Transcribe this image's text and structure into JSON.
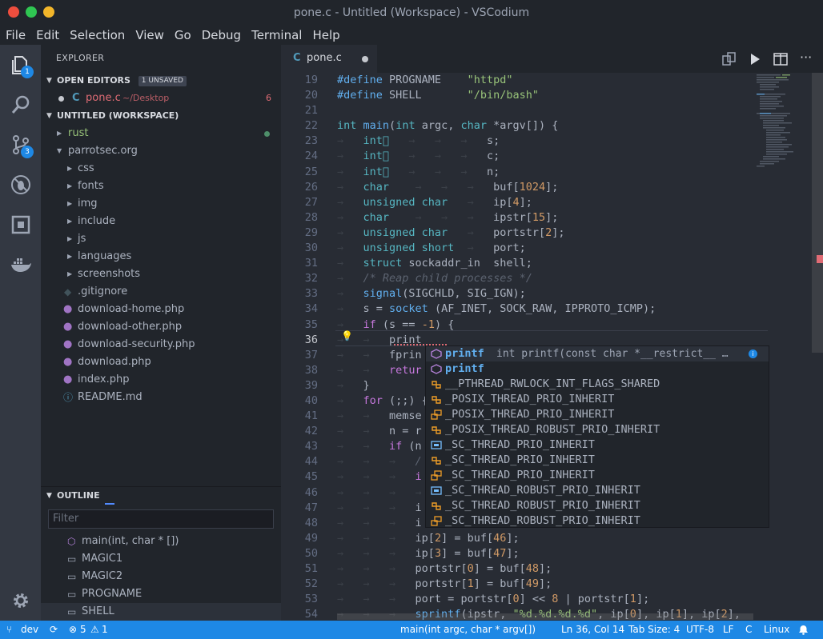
{
  "window": {
    "title": "pone.c - Untitled (Workspace) - VSCodium"
  },
  "menu": [
    "File",
    "Edit",
    "Selection",
    "View",
    "Go",
    "Debug",
    "Terminal",
    "Help"
  ],
  "activity": {
    "explorer_badge": "1",
    "scm_badge": "3"
  },
  "sidebar": {
    "header": "EXPLORER",
    "open_editors": {
      "title": "OPEN EDITORS",
      "badge": "1 UNSAVED",
      "items": [
        {
          "icon": "C",
          "name": "pone.c",
          "path": "~/Desktop",
          "problems": "6"
        }
      ]
    },
    "workspace": {
      "title": "UNTITLED (WORKSPACE)",
      "items": [
        {
          "name": "rust",
          "kind": "folder",
          "depth": 0
        },
        {
          "name": "parrotsec.org",
          "kind": "folder-open",
          "depth": 0
        },
        {
          "name": "css",
          "kind": "folder",
          "depth": 1
        },
        {
          "name": "fonts",
          "kind": "folder",
          "depth": 1
        },
        {
          "name": "img",
          "kind": "folder",
          "depth": 1
        },
        {
          "name": "include",
          "kind": "folder",
          "depth": 1
        },
        {
          "name": "js",
          "kind": "folder",
          "depth": 1
        },
        {
          "name": "languages",
          "kind": "folder",
          "depth": 1
        },
        {
          "name": "screenshots",
          "kind": "folder",
          "depth": 1
        },
        {
          "name": ".gitignore",
          "kind": "git",
          "depth": 1
        },
        {
          "name": "download-home.php",
          "kind": "php",
          "depth": 1
        },
        {
          "name": "download-other.php",
          "kind": "php",
          "depth": 1
        },
        {
          "name": "download-security.php",
          "kind": "php",
          "depth": 1
        },
        {
          "name": "download.php",
          "kind": "php",
          "depth": 1
        },
        {
          "name": "index.php",
          "kind": "php",
          "depth": 1
        },
        {
          "name": "README.md",
          "kind": "info",
          "depth": 1
        }
      ]
    },
    "outline": {
      "title": "OUTLINE",
      "filter_placeholder": "Filter",
      "items": [
        "main(int, char * [])",
        "MAGIC1",
        "MAGIC2",
        "PROGNAME",
        "SHELL"
      ]
    }
  },
  "editor": {
    "tab_icon": "C",
    "tab_name": "pone.c",
    "line_numbers": [
      "19",
      "20",
      "21",
      "22",
      "23",
      "24",
      "25",
      "26",
      "27",
      "28",
      "29",
      "30",
      "31",
      "32",
      "33",
      "34",
      "35",
      "36",
      "37",
      "38",
      "39",
      "40",
      "41",
      "42",
      "43",
      "44",
      "45",
      "46",
      "47",
      "48",
      "49",
      "50",
      "51",
      "52",
      "53",
      "54"
    ],
    "active_line": "36"
  },
  "suggest": {
    "items": [
      {
        "label": "printf",
        "detail": "int printf(const char *__restrict__ …",
        "kind": "function"
      },
      {
        "label": "printf",
        "detail": "",
        "kind": "function"
      },
      {
        "label": "__PTHREAD_RWLOCK_INT_FLAGS_SHARED",
        "detail": "",
        "kind": "constant"
      },
      {
        "label": "_POSIX_THREAD_PRIO_INHERIT",
        "detail": "",
        "kind": "constant"
      },
      {
        "label": "_POSIX_THREAD_PRIO_INHERIT",
        "detail": "",
        "kind": "enum"
      },
      {
        "label": "_POSIX_THREAD_ROBUST_PRIO_INHERIT",
        "detail": "",
        "kind": "constant"
      },
      {
        "label": "_SC_THREAD_PRIO_INHERIT",
        "detail": "",
        "kind": "member"
      },
      {
        "label": "_SC_THREAD_PRIO_INHERIT",
        "detail": "",
        "kind": "constant"
      },
      {
        "label": "_SC_THREAD_PRIO_INHERIT",
        "detail": "",
        "kind": "enum"
      },
      {
        "label": "_SC_THREAD_ROBUST_PRIO_INHERIT",
        "detail": "",
        "kind": "member"
      },
      {
        "label": "_SC_THREAD_ROBUST_PRIO_INHERIT",
        "detail": "",
        "kind": "constant"
      },
      {
        "label": "_SC_THREAD_ROBUST_PRIO_INHERIT",
        "detail": "",
        "kind": "enum"
      }
    ]
  },
  "status": {
    "branch": "dev",
    "errors": "5",
    "warnings": "1",
    "symbol": "main(int argc, char * argv[])",
    "position": "Ln 36, Col 14",
    "tab_size": "Tab Size: 4",
    "encoding": "UTF-8",
    "eol": "LF",
    "language": "C",
    "os": "Linux"
  },
  "colors": {
    "accent": "#1e88e5",
    "editor_bg": "#282c34",
    "sidebar_bg": "#21252b"
  }
}
